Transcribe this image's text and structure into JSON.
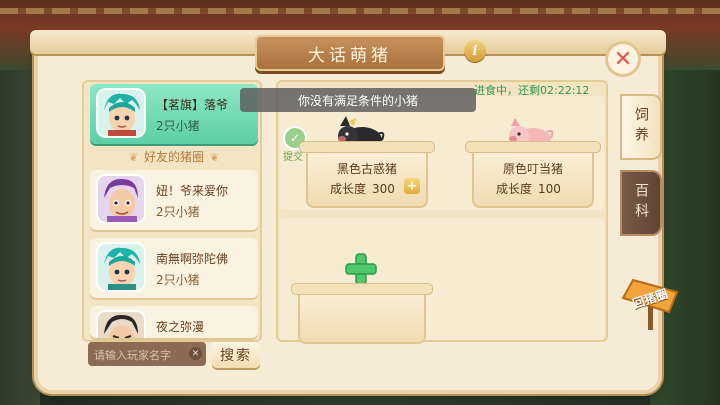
{
  "window": {
    "title": "大话萌猪"
  },
  "header": {
    "info_glyph": "i",
    "close_glyph": "✕"
  },
  "toast": "你没有满足条件的小猪",
  "feed_status": "进食中，还剩02:22:12",
  "feed_check_label": "提交",
  "friends": {
    "me": {
      "name": "【茗旗】落爷",
      "count": "2只小猪"
    },
    "section_title": "好友的猪圈",
    "list": [
      {
        "name": "妞！爷来爱你",
        "count": "2只小猪"
      },
      {
        "name": "南無啊弥陀佛",
        "count": "2只小猪"
      },
      {
        "name": "夜之弥漫",
        "count": ""
      }
    ]
  },
  "search": {
    "placeholder": "请输入玩家名字",
    "clear_glyph": "✕",
    "button_label": "搜索"
  },
  "pigs": [
    {
      "name": "黑色古惑猪",
      "growth_label": "成长度",
      "growth_value": "300",
      "add_glyph": "+"
    },
    {
      "name": "原色叮当猪",
      "growth_label": "成长度",
      "growth_value": "100"
    }
  ],
  "tabs": [
    {
      "label": "饲养",
      "active": true
    },
    {
      "label": "百科",
      "active": false
    }
  ],
  "back_button": {
    "label": "回猪圈"
  },
  "colors": {
    "accent_green": "#5ccfa6",
    "frame": "#f6ecd6",
    "text_brown": "#6a3f1d",
    "timer_green": "#2e9a4a"
  }
}
